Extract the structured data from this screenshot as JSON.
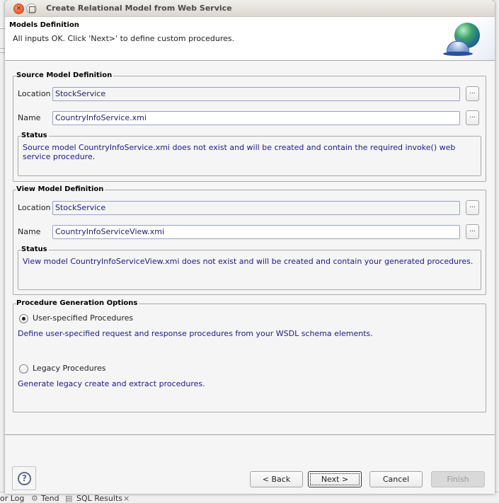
{
  "window": {
    "title": "Create Relational Model from Web Service",
    "close_icon": "close-icon",
    "maximize_icon": "maximize-icon"
  },
  "header": {
    "title": "Models Definition",
    "message": "All inputs OK. Click 'Next>' to define custom procedures.",
    "banner_icon": "globe-bell-icon"
  },
  "source_model": {
    "legend": "Source Model Definition",
    "location_label": "Location",
    "location_value": "StockService",
    "name_label": "Name",
    "name_value": "CountryInfoService.xmi",
    "browse_label": "...",
    "status_legend": "Status",
    "status_text": "Source model CountryInfoService.xmi does not exist and will be created and contain the required invoke() web service procedure."
  },
  "view_model": {
    "legend": "View Model Definition",
    "location_label": "Location",
    "location_value": "StockService",
    "name_label": "Name",
    "name_value": "CountryInfoServiceView.xmi",
    "browse_label": "...",
    "status_legend": "Status",
    "status_text": "View model CountryInfoServiceView.xmi does not exist and will be created and contain your generated procedures."
  },
  "procedure_options": {
    "legend": "Procedure Generation Options",
    "options": [
      {
        "label": "User-specified Procedures",
        "checked": true,
        "description": "Define user-specified request and response procedures from your WSDL schema elements."
      },
      {
        "label": "Legacy Procedures",
        "checked": false,
        "description": "Generate legacy create and extract procedures."
      }
    ]
  },
  "footer": {
    "help_label": "?",
    "back_label": "< Back",
    "next_label": "Next >",
    "cancel_label": "Cancel",
    "finish_label": "Finish",
    "finish_enabled": false
  },
  "background": {
    "tabs": [
      "or Log",
      "Tend",
      "SQL Results"
    ]
  }
}
